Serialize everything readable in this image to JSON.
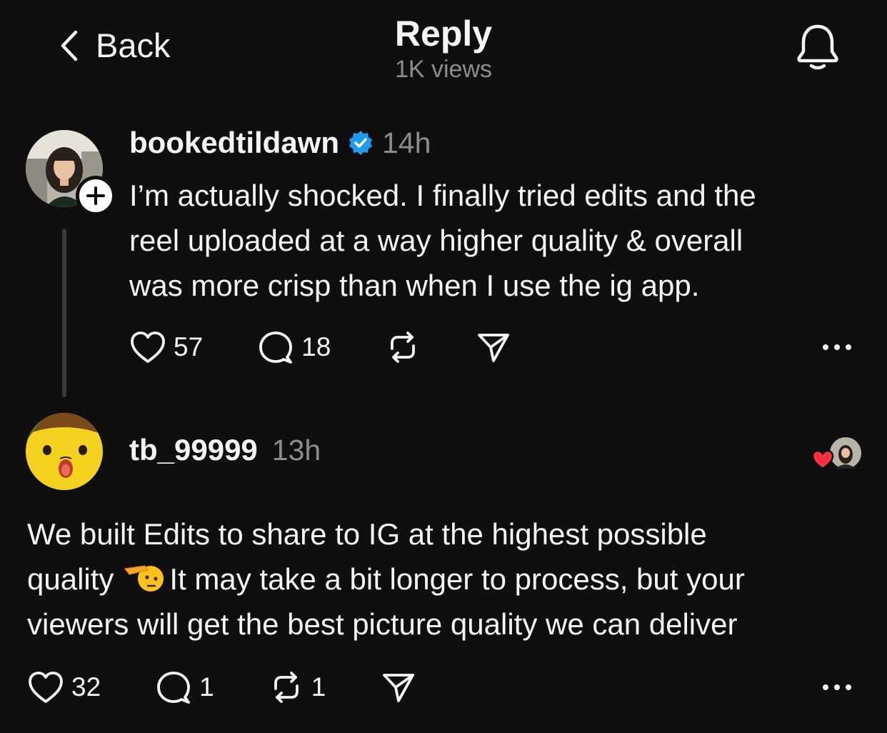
{
  "header": {
    "back_label": "Back",
    "title": "Reply",
    "views": "1K views"
  },
  "post": {
    "username": "bookedtildawn",
    "time": "14h",
    "text_lines": [
      "I’m actually shocked. I finally tried edits and the",
      "reel uploaded at a way higher quality & overall",
      "was more crisp than when I use the ig app."
    ],
    "likes": "57",
    "comments": "18"
  },
  "reply": {
    "username": "tb_99999",
    "time": "13h",
    "text_line1": "We built Edits to share to IG at the highest possible",
    "text_line2_start": "quality",
    "text_line2_end": "It may take a bit longer to process, but your",
    "text_line3": "viewers will get the best picture quality we can deliver",
    "likes": "32",
    "comments": "1",
    "reposts": "1"
  },
  "colors": {
    "background": "#0f0f0f",
    "text": "#f3f5f7",
    "muted": "#8c8c8c",
    "verified": "#1d9bf0",
    "heart": "#ff3040"
  },
  "icons": {
    "back": "chevron-left-icon",
    "bell": "bell-icon",
    "verified": "verified-badge-icon",
    "like": "heart-icon",
    "comment": "comment-icon",
    "repost": "repost-icon",
    "share": "send-icon",
    "more": "more-horizontal-icon",
    "follow": "plus-icon",
    "salute": "saluting-face-emoji"
  }
}
